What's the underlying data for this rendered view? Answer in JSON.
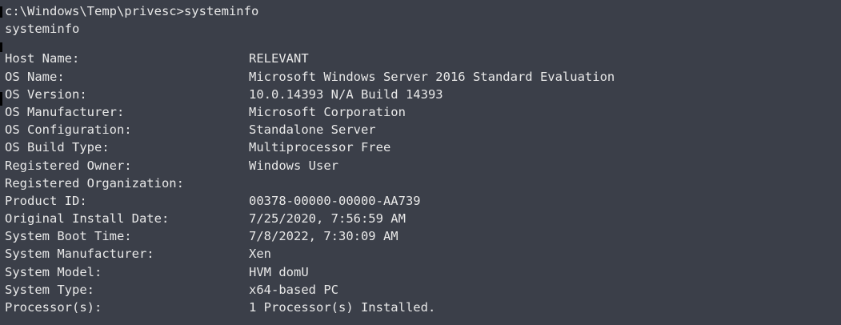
{
  "terminal": {
    "prompt_line": "c:\\Windows\\Temp\\privesc>systeminfo",
    "echo_line": "systeminfo",
    "rows": [
      {
        "key": "Host Name:",
        "value": "RELEVANT"
      },
      {
        "key": "OS Name:",
        "value": "Microsoft Windows Server 2016 Standard Evaluation"
      },
      {
        "key": "OS Version:",
        "value": "10.0.14393 N/A Build 14393"
      },
      {
        "key": "OS Manufacturer:",
        "value": "Microsoft Corporation"
      },
      {
        "key": "OS Configuration:",
        "value": "Standalone Server"
      },
      {
        "key": "OS Build Type:",
        "value": "Multiprocessor Free"
      },
      {
        "key": "Registered Owner:",
        "value": "Windows User"
      },
      {
        "key": "Registered Organization:",
        "value": ""
      },
      {
        "key": "Product ID:",
        "value": "00378-00000-00000-AA739"
      },
      {
        "key": "Original Install Date:",
        "value": "7/25/2020, 7:56:59 AM"
      },
      {
        "key": "System Boot Time:",
        "value": "7/8/2022, 7:30:09 AM"
      },
      {
        "key": "System Manufacturer:",
        "value": "Xen"
      },
      {
        "key": "System Model:",
        "value": "HVM domU"
      },
      {
        "key": "System Type:",
        "value": "x64-based PC"
      },
      {
        "key": "Processor(s):",
        "value": "1 Processor(s) Installed."
      }
    ],
    "colors": {
      "background": "#3b3f49",
      "text": "#e8e8e8"
    }
  }
}
